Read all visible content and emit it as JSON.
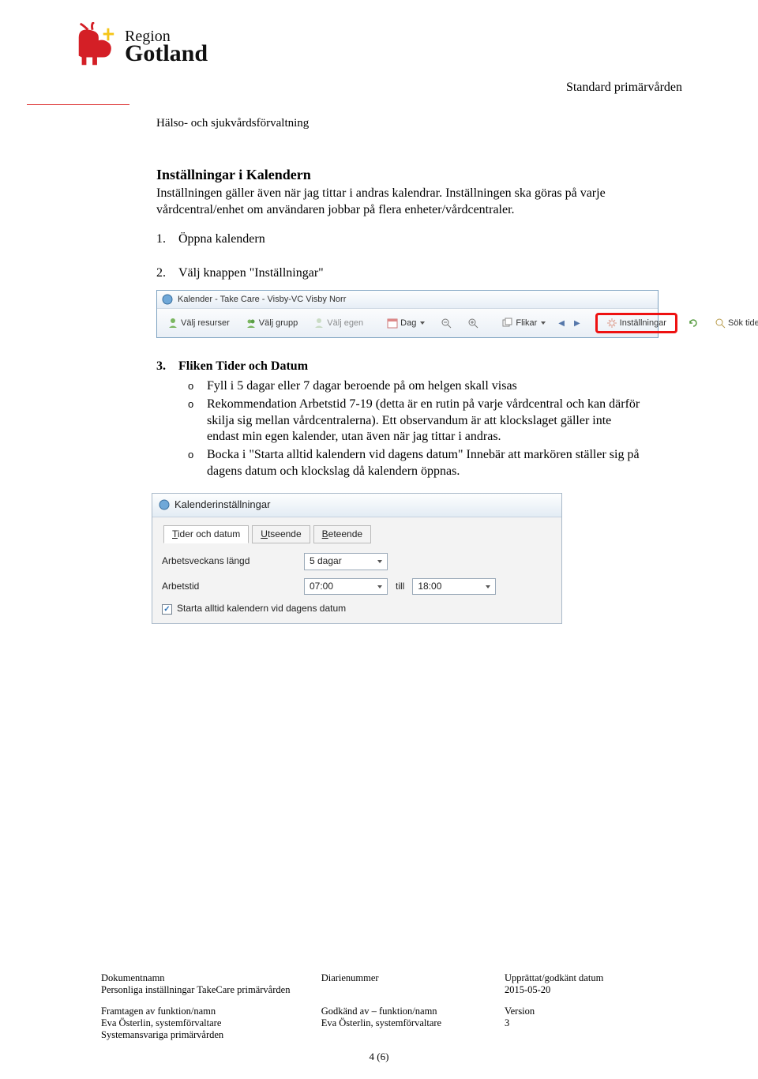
{
  "logo": {
    "line1": "Region",
    "line2": "Gotland"
  },
  "doc_category": "Standard primärvården",
  "sub_header": "Hälso- och sjukvårdsförvaltning",
  "section_title": "Inställningar i Kalendern",
  "intro": "Inställningen gäller även när jag tittar i andras kalendrar. Inställningen ska göras på varje vårdcentral/enhet om användaren jobbar på flera enheter/vårdcentraler.",
  "steps": {
    "s1": {
      "num": "1.",
      "text": "Öppna kalendern"
    },
    "s2": {
      "num": "2.",
      "text": "Välj knappen \"Inställningar\""
    },
    "s3": {
      "num": "3.",
      "title": "Fliken Tider och Datum",
      "bullets": {
        "b1": "Fyll i 5 dagar eller 7 dagar beroende på om helgen skall visas",
        "b2": "Rekommendation Arbetstid 7-19  (detta är en rutin på varje vårdcentral och kan därför skilja sig mellan vårdcentralerna). Ett observandum är att klockslaget gäller inte endast min egen kalender, utan även när jag tittar i andras.",
        "b3": "Bocka i \"Starta alltid kalendern vid dagens datum\" Innebär att markören ställer sig på dagens datum och klockslag då kalendern öppnas."
      }
    }
  },
  "toolbar": {
    "window_title": "Kalender - Take Care - Visby-VC Visby Norr",
    "btns": {
      "valj_resurser": "Välj resurser",
      "valj_grupp": "Välj grupp",
      "valj_egen": "Välj egen",
      "dag": "Dag",
      "flikar": "Flikar",
      "installningar": "Inställningar",
      "sok_tider": "Sök tider"
    }
  },
  "dialog": {
    "title": "Kalenderinställningar",
    "tabs": {
      "t1": "Tider och datum",
      "t2": "Utseende",
      "t3": "Beteende"
    },
    "labels": {
      "arbetsveckans": "Arbetsveckans längd",
      "arbetstid": "Arbetstid",
      "till": "till",
      "checkbox": "Starta alltid kalendern vid dagens datum"
    },
    "values": {
      "length": "5 dagar",
      "from": "07:00",
      "to": "18:00"
    }
  },
  "footer": {
    "dn_h": "Dokumentnamn",
    "dn_v": "Personliga inställningar TakeCare primärvården",
    "diar_h": "Diarienummer",
    "upp_h": "Upprättat/godkänt datum",
    "upp_v": "2015-05-20",
    "fram_h": "Framtagen av funktion/namn",
    "fram_v1": "Eva Österlin, systemförvaltare",
    "fram_v2": "Systemansvariga primärvården",
    "god_h": "Godkänd av – funktion/namn",
    "god_v": "Eva Österlin, systemförvaltare",
    "ver_h": "Version",
    "ver_v": "3",
    "page": "4 (6)"
  }
}
